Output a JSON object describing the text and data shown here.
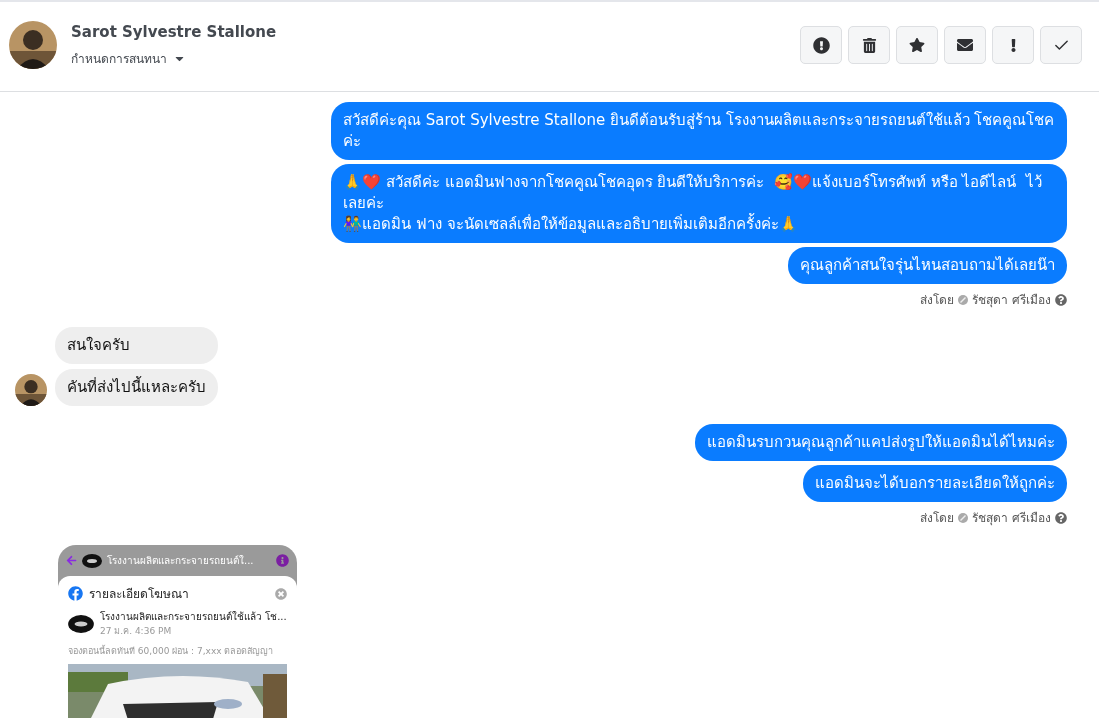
{
  "header": {
    "contact_name": "Sarot Sylvestre Stallone",
    "conversation_menu": "กำหนดการสนทนา"
  },
  "actions": [
    {
      "kind": "report"
    },
    {
      "kind": "delete"
    },
    {
      "kind": "star"
    },
    {
      "kind": "mail"
    },
    {
      "kind": "important"
    },
    {
      "kind": "done"
    }
  ],
  "thread": [
    {
      "kind": "outgoing",
      "bubbles": [
        "สวัสดีค่ะคุณ Sarot Sylvestre Stallone ยินดีต้อนรับสู่ร้าน โรงงานผลิตและกระจายรถยนต์ใช้แล้ว โชคคูณโชคค่ะ",
        "🙏❤️ สวัสดีค่ะ แอดมินฟางจากโชคคูณโชคอุดร ยินดีให้บริการค่ะ  🥰❤️แจ้งเบอร์โทรศัพท์ หรือ ไอดีไลน์  ไว้เลยค่ะ\n👫แอดมิน ฟาง จะนัดเซลล์เพื่อให้ข้อมูลและอธิบายเพิ่มเติมอีกครั้งค่ะ🙏",
        "คุณลูกค้าสนใจรุ่นไหนสอบถามได้เลยน๊า"
      ],
      "sent_by_label": "ส่งโดย",
      "sender": "รัชสุดา ศรีเมือง"
    },
    {
      "kind": "incoming",
      "bubbles": [
        "สนใจครับ",
        "คันที่ส่งไปนี้แหละครับ"
      ]
    },
    {
      "kind": "outgoing",
      "bubbles": [
        "แอดมินรบกวนคุณลูกค้าแคปส่งรูปให้แอดมินได้ไหมค่ะ",
        "แอดมินจะได้บอกรายละเอียดให้ถูกค่ะ"
      ],
      "sent_by_label": "ส่งโดย",
      "sender": "รัชสุดา ศรีเมือง"
    },
    {
      "kind": "screenshot",
      "app_title": "โรงงานผลิตและกระจายรถยนต์ใ...",
      "panel_title": "รายละเอียดโฆษณา",
      "post_author": "โรงงานผลิตและกระจายรถยนต์ใช้แล้ว โช...",
      "post_time": "27 ม.ค. 4:36 PM",
      "post_caption": "จองตอนนี้ลดทันที 60,000 ผ่อน : 7,xxx ตลอดสัญญา"
    }
  ]
}
